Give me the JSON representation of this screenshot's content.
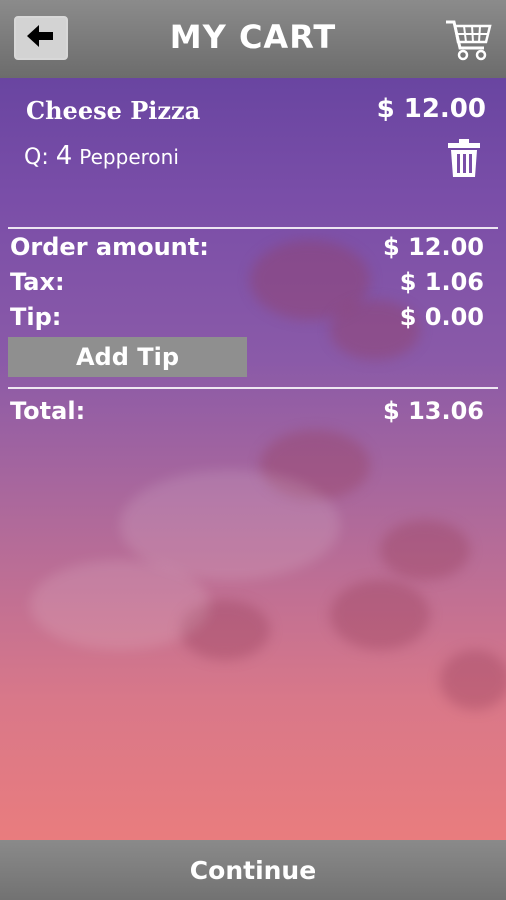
{
  "header": {
    "back_icon": "left-arrow-icon",
    "title": "MY CART",
    "cart_icon": "shopping-cart-icon"
  },
  "cart_item": {
    "name": "Cheese Pizza",
    "price": "$ 12.00",
    "qty_label": "Q:",
    "qty_value": "4",
    "topping": "Pepperoni",
    "delete_icon": "trash-icon"
  },
  "summary": {
    "order_amount_label": "Order amount:",
    "order_amount_value": "$ 12.00",
    "tax_label": "Tax:",
    "tax_value": "$ 1.06",
    "tip_label": "Tip:",
    "tip_value": "$ 0.00",
    "add_tip_label": "Add Tip",
    "total_label": "Total:",
    "total_value": "$ 13.06"
  },
  "footer": {
    "continue_label": "Continue"
  }
}
